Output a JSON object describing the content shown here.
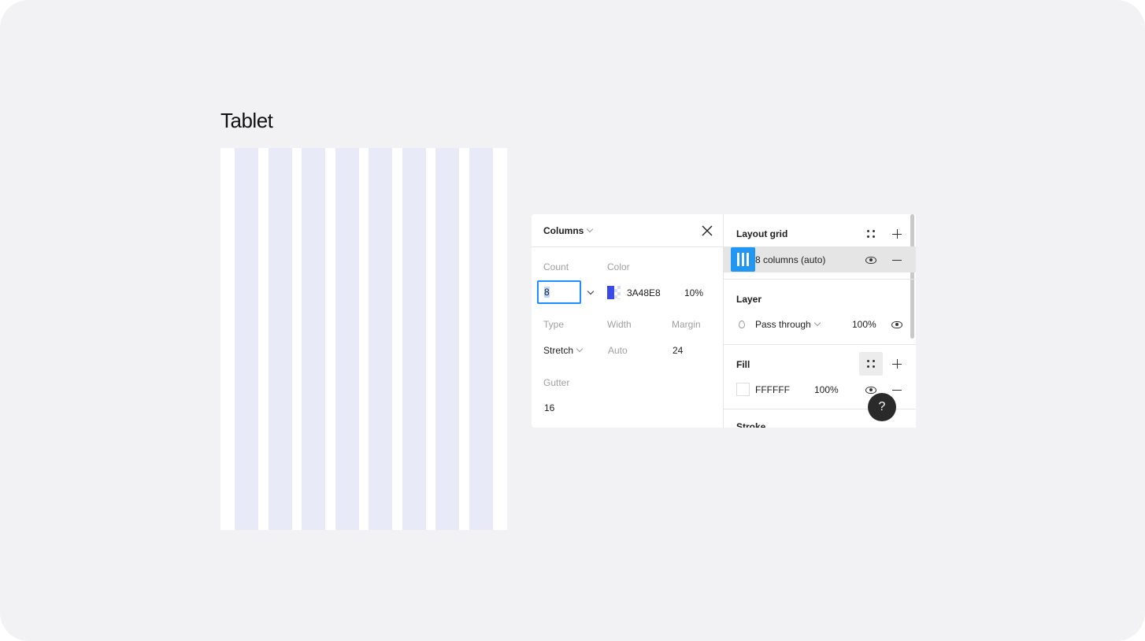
{
  "canvas": {
    "frame_title": "Tablet",
    "column_count": 8,
    "column_color": "#3a48e8"
  },
  "grid_settings": {
    "type_dropdown": "Columns",
    "count_label": "Count",
    "count_value": "8",
    "color_label": "Color",
    "color_hex": "3A48E8",
    "color_opacity": "10%",
    "type_label": "Type",
    "type_value": "Stretch",
    "width_label": "Width",
    "width_value": "Auto",
    "margin_label": "Margin",
    "margin_value": "24",
    "gutter_label": "Gutter",
    "gutter_value": "16"
  },
  "properties": {
    "layout_grid": {
      "title": "Layout grid",
      "item_label": "8 columns (auto)"
    },
    "layer": {
      "title": "Layer",
      "blend_mode": "Pass through",
      "opacity": "100%"
    },
    "fill": {
      "title": "Fill",
      "hex": "FFFFFF",
      "opacity": "100%"
    },
    "stroke": {
      "title": "Stroke"
    }
  },
  "help": {
    "label": "?"
  },
  "colors": {
    "accent": "#2196f3",
    "focus": "#1e90ff"
  }
}
